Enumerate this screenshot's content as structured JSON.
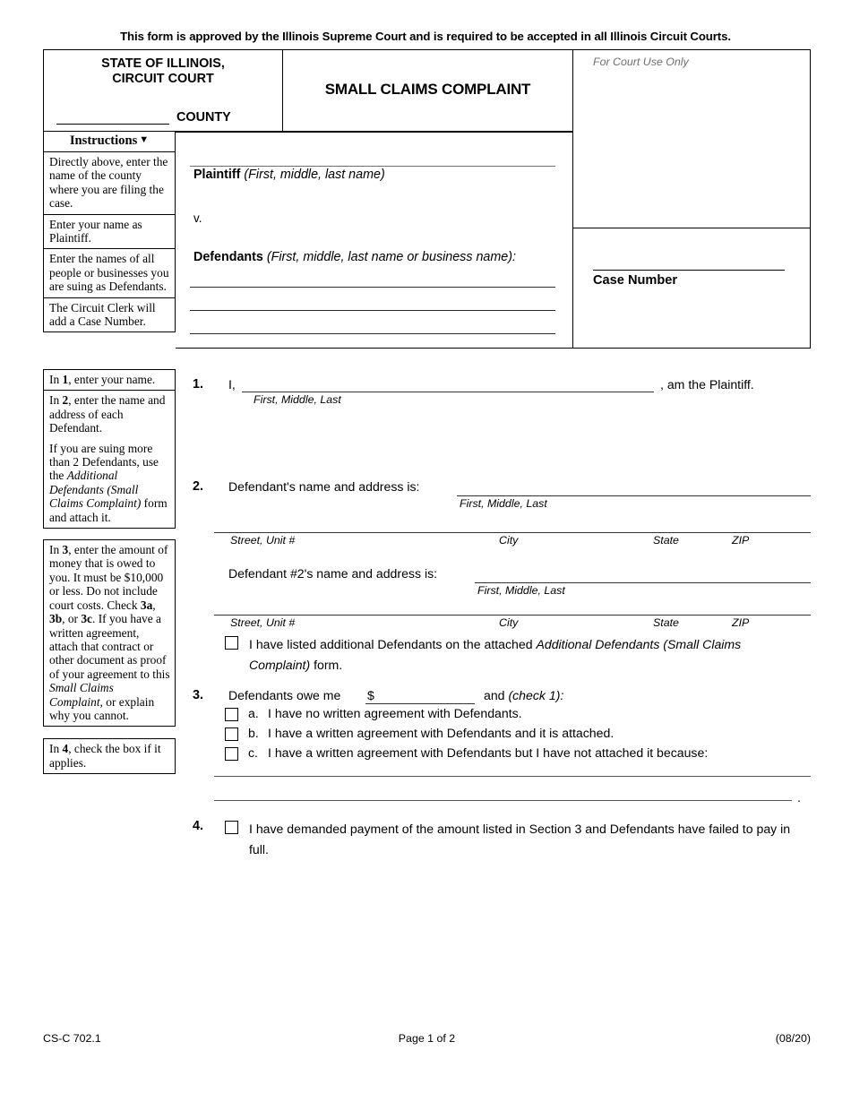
{
  "approval_notice": "This form is approved by the Illinois Supreme Court and is required to be accepted in all Illinois Circuit Courts.",
  "caption": {
    "state_line1": "STATE OF ILLINOIS,",
    "state_line2": "CIRCUIT COURT",
    "county_label": "COUNTY",
    "form_title": "SMALL CLAIMS COMPLAINT",
    "court_use_only": "For Court Use Only",
    "case_number_label": "Case Number"
  },
  "instructions_header": {
    "label": "Instructions",
    "caret_icon": "chevron-down-icon"
  },
  "instructions": [
    "Directly above, enter the name of the county where you are filing the case.",
    "Enter your name as Plaintiff.",
    "Enter the names of all people or businesses you are suing as Defendants.",
    "The Circuit Clerk will add a Case Number."
  ],
  "parties": {
    "plaintiff_label": "Plaintiff",
    "plaintiff_hint": "(First, middle, last name)",
    "versus": "v.",
    "defendants_label": "Defendants",
    "defendants_hint": "(First, middle, last name or business name):"
  },
  "body_instructions": {
    "box1": "In 1, enter your name.",
    "box2_p1": "In 2, enter the name and address of each Defendant.",
    "box2_p2_a": "If you are suing more than 2 Defendants, use the ",
    "box2_p2_i": "Additional Defendants (Small Claims Complaint)",
    "box2_p2_b": " form and attach it.",
    "box3_a": "In 3, enter the amount of money that is owed to you. It must be $10,000 or less. Do not include court costs. Check 3a, 3b, or 3c. If you have a written agreement, attach that contract or other document as proof of your agreement to this ",
    "box3_i": "Small Claims Complaint,",
    "box3_b": " or explain why you cannot.",
    "box4": "In 4, check the box if it applies."
  },
  "sections": {
    "s1": {
      "number": "1.",
      "i_word": "I,",
      "sub_label": "First, Middle, Last",
      "tail": ", am the Plaintiff."
    },
    "s2": {
      "number": "2.",
      "label1": "Defendant's name and address is:",
      "sub1": "First, Middle, Last",
      "addr_street": "Street, Unit #",
      "addr_city": "City",
      "addr_state": "State",
      "addr_zip": "ZIP",
      "label2": "Defendant #2's name and address is:",
      "sub2": "First, Middle, Last",
      "checkbox_text_a": "I have listed additional Defendants on the attached ",
      "checkbox_text_i": "Additional Defendants (Small Claims Complaint)",
      "checkbox_text_b": " form.",
      "checkbox_state": "unchecked"
    },
    "s3": {
      "number": "3.",
      "label": "Defendants owe me",
      "dollar_sign": "$",
      "amount_value": "",
      "and_check": "and",
      "check_one": "(check 1):",
      "options": [
        {
          "letter": "a.",
          "text": "I have no written agreement with Defendants.",
          "state": "unchecked"
        },
        {
          "letter": "b.",
          "text": "I have a written agreement with Defendants and it is attached.",
          "state": "unchecked"
        },
        {
          "letter": "c.",
          "text": "I have a written agreement with Defendants but I have not attached it because:",
          "state": "unchecked"
        }
      ],
      "explanation_line1": "",
      "explanation_line2": "",
      "period": "."
    },
    "s4": {
      "number": "4.",
      "text": "I have demanded payment of the amount listed in Section 3 and Defendants have failed to pay in full.",
      "checkbox_state": "unchecked"
    }
  },
  "footer": {
    "form_code": "CS-C 702.1",
    "page_label": "Page 1 of 2",
    "revision": "(08/20)"
  }
}
